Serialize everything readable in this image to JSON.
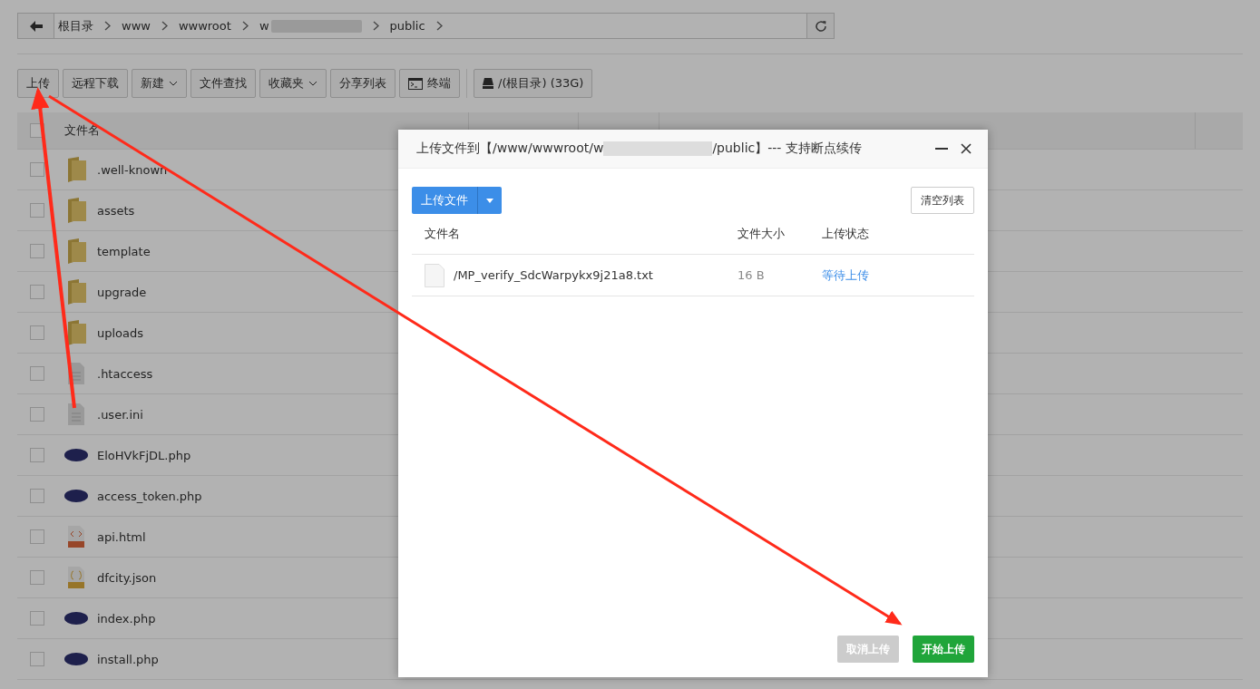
{
  "breadcrumb": {
    "items": [
      {
        "label": "根目录",
        "redacted": false
      },
      {
        "label": "www",
        "redacted": false
      },
      {
        "label": "wwwroot",
        "redacted": false
      },
      {
        "label": "w",
        "redacted": true
      },
      {
        "label": "public",
        "redacted": false
      }
    ]
  },
  "toolbar": {
    "buttons": [
      {
        "label": "上传",
        "kind": "plain"
      },
      {
        "label": "远程下载",
        "kind": "plain"
      },
      {
        "label": "新建",
        "kind": "dropdown"
      },
      {
        "label": "文件查找",
        "kind": "plain"
      },
      {
        "label": "收藏夹",
        "kind": "dropdown"
      },
      {
        "label": "分享列表",
        "kind": "plain"
      },
      {
        "label": "终端",
        "kind": "terminal"
      },
      {
        "label": "/(根目录) (33G)",
        "kind": "disk"
      }
    ]
  },
  "table": {
    "select_all_checked": false,
    "columns": [
      "文件名"
    ],
    "rows": [
      {
        "name": ".well-known",
        "kind": "folder",
        "checked": false
      },
      {
        "name": "assets",
        "kind": "folder",
        "checked": false
      },
      {
        "name": "template",
        "kind": "folder",
        "checked": false
      },
      {
        "name": "upgrade",
        "kind": "folder",
        "checked": false
      },
      {
        "name": "uploads",
        "kind": "folder",
        "checked": false
      },
      {
        "name": ".htaccess",
        "kind": "text",
        "checked": false
      },
      {
        "name": ".user.ini",
        "kind": "text",
        "checked": false
      },
      {
        "name": "EloHVkFjDL.php",
        "kind": "php",
        "checked": false
      },
      {
        "name": "access_token.php",
        "kind": "php",
        "checked": false
      },
      {
        "name": "api.html",
        "kind": "html",
        "checked": false
      },
      {
        "name": "dfcity.json",
        "kind": "json",
        "checked": false
      },
      {
        "name": "index.php",
        "kind": "php",
        "checked": false
      },
      {
        "name": "install.php",
        "kind": "php",
        "checked": false
      }
    ]
  },
  "dialog": {
    "title_prefix": "上传文件到【/www/wwwroot/w",
    "title_suffix": "/public】--- 支持断点续传",
    "upload_button": "上传文件",
    "clear_button": "清空列表",
    "columns": [
      "文件名",
      "文件大小",
      "上传状态"
    ],
    "files": [
      {
        "name": "/MP_verify_SdcWarpykx9j21a8.txt",
        "size": "16 B",
        "status": "等待上传"
      }
    ],
    "cancel_button": {
      "label": "取消上传",
      "disabled": true
    },
    "start_button": {
      "label": "开始上传",
      "disabled": false
    }
  }
}
